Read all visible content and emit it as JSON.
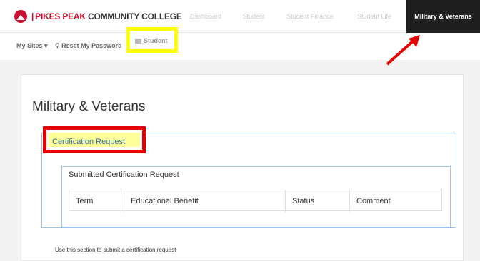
{
  "brand": {
    "name_part1": "PIKES PEAK",
    "name_part2": " COMMUNITY COLLEGE"
  },
  "topnav": {
    "items": [
      {
        "label": "Dashboard"
      },
      {
        "label": "Student"
      },
      {
        "label": "Student Finance"
      },
      {
        "label": "Student Life"
      },
      {
        "label": "Military & Veterans"
      }
    ],
    "active": "Military & Veterans"
  },
  "subnav": {
    "my_sites": "My Sites ▾",
    "reset_password": "⚲ Reset My Password",
    "student": "Student"
  },
  "main": {
    "title": "Military & Veterans",
    "certification_tab": "Certification Request",
    "submitted_title": "Submitted Certification Request",
    "table_headers": [
      "Term",
      "Educational Benefit",
      "Status",
      "Comment"
    ],
    "note": "Use this section to submit a certification request"
  },
  "colors": {
    "highlight_yellow": "#ffff00",
    "highlight_red": "#e60000",
    "active_nav": "#1f1f1f",
    "panel_border": "#9ec3e6"
  }
}
